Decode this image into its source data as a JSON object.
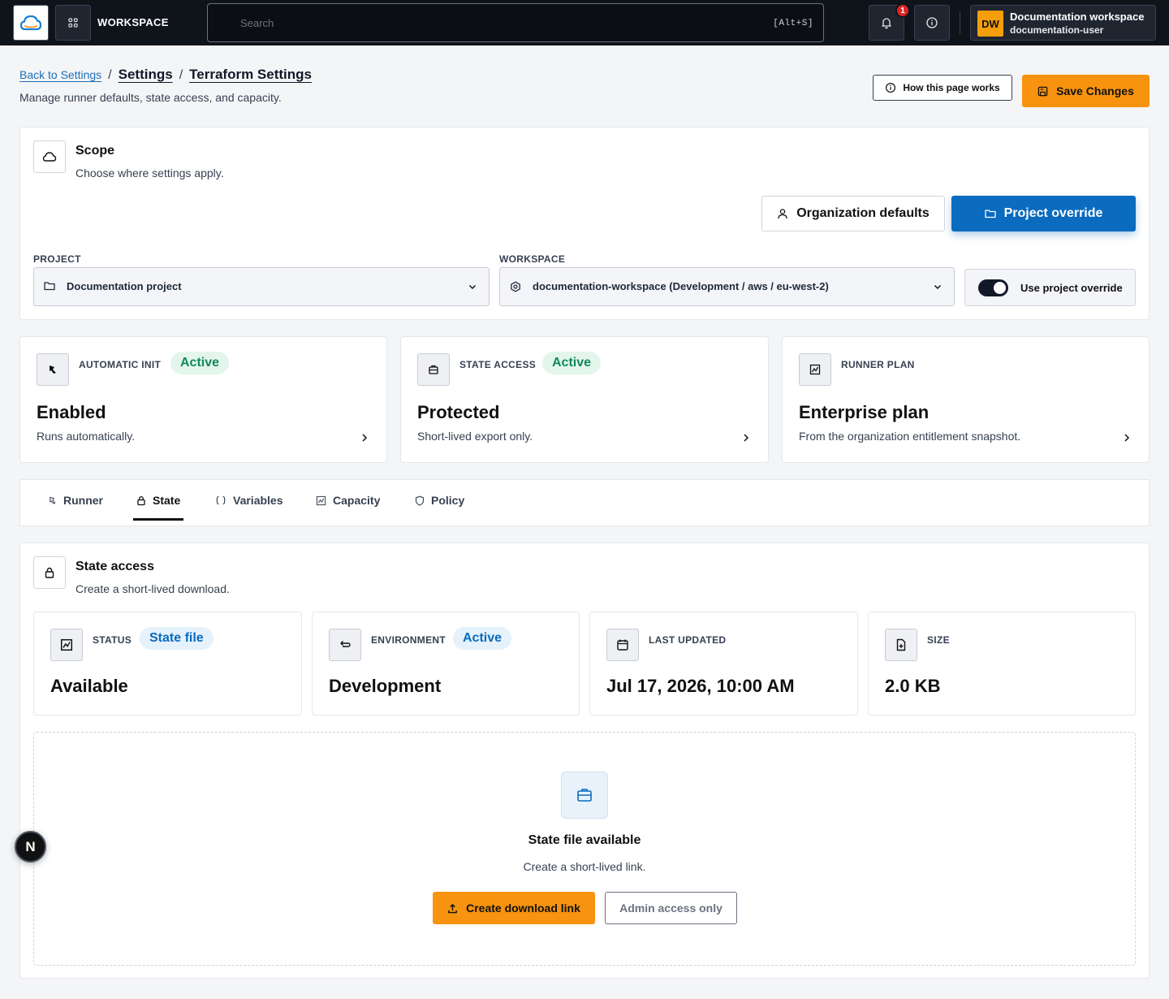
{
  "topbar": {
    "workspace_label": "WORKSPACE",
    "search_placeholder": "Search",
    "search_shortcut": "[Alt+S]",
    "notification_count": "1",
    "user_initials": "DW",
    "user_workspace": "Documentation workspace",
    "user_name": "documentation-user"
  },
  "header": {
    "breadcrumb_back": "Back to Settings",
    "breadcrumb_settings": "Settings",
    "breadcrumb_current": "Terraform Settings",
    "separator": "/",
    "subtitle": "Manage runner defaults, state access, and capacity.",
    "how_button": "How this page works",
    "save_button": "Save Changes"
  },
  "scope": {
    "title": "Scope",
    "subtitle": "Choose where settings apply.",
    "org_button": "Organization defaults",
    "project_button": "Project override",
    "project_label": "PROJECT",
    "project_value": "Documentation project",
    "workspace_label": "WORKSPACE",
    "workspace_value": "documentation-workspace (Development / aws / eu-west-2)",
    "toggle_label": "Use project override",
    "toggle_on": true
  },
  "summary": [
    {
      "label": "AUTOMATIC INIT",
      "badge": "Active",
      "value": "Enabled",
      "sub": "Runs automatically."
    },
    {
      "label": "STATE ACCESS",
      "badge": "Active",
      "value": "Protected",
      "sub": "Short-lived export only."
    },
    {
      "label": "RUNNER PLAN",
      "badge": "",
      "value": "Enterprise plan",
      "sub": "From the organization entitlement snapshot."
    }
  ],
  "tabs": [
    {
      "label": "Runner",
      "icon": "runner-icon"
    },
    {
      "label": "State",
      "icon": "lock-icon",
      "active": true
    },
    {
      "label": "Variables",
      "icon": "braces-icon"
    },
    {
      "label": "Capacity",
      "icon": "chart-icon"
    },
    {
      "label": "Policy",
      "icon": "shield-icon"
    }
  ],
  "state": {
    "title": "State access",
    "subtitle": "Create a short-lived download.",
    "stats": [
      {
        "label": "STATUS",
        "badge": "State file",
        "value": "Available"
      },
      {
        "label": "ENVIRONMENT",
        "badge": "Active",
        "value": "Development"
      },
      {
        "label": "LAST UPDATED",
        "badge": "",
        "value": "Jul 17, 2026, 10:00 AM"
      },
      {
        "label": "SIZE",
        "badge": "",
        "value": "2.0 KB"
      }
    ],
    "empty_title": "State file available",
    "empty_sub": "Create a short-lived link.",
    "download_button": "Create download link",
    "admin_button": "Admin access only"
  },
  "dev_badge": "N",
  "colors": {
    "accent_orange": "#f7930e",
    "accent_blue": "#0a6bbf",
    "success_green": "#12895a",
    "topbar_bg": "#0f141b"
  }
}
